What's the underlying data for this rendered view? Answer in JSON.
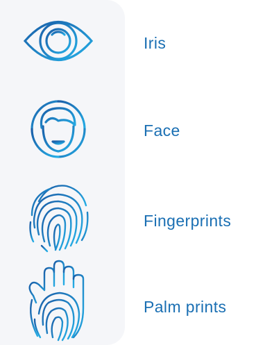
{
  "accent_color": "#1a6fb3",
  "icon_gradient": [
    "#1a5ea8",
    "#25aee6"
  ],
  "items": [
    {
      "label": "Iris",
      "icon": "iris-scan-icon"
    },
    {
      "label": "Face",
      "icon": "face-scan-icon"
    },
    {
      "label": "Fingerprints",
      "icon": "fingerprint-icon"
    },
    {
      "label": "Palm prints",
      "icon": "palm-print-icon"
    }
  ]
}
